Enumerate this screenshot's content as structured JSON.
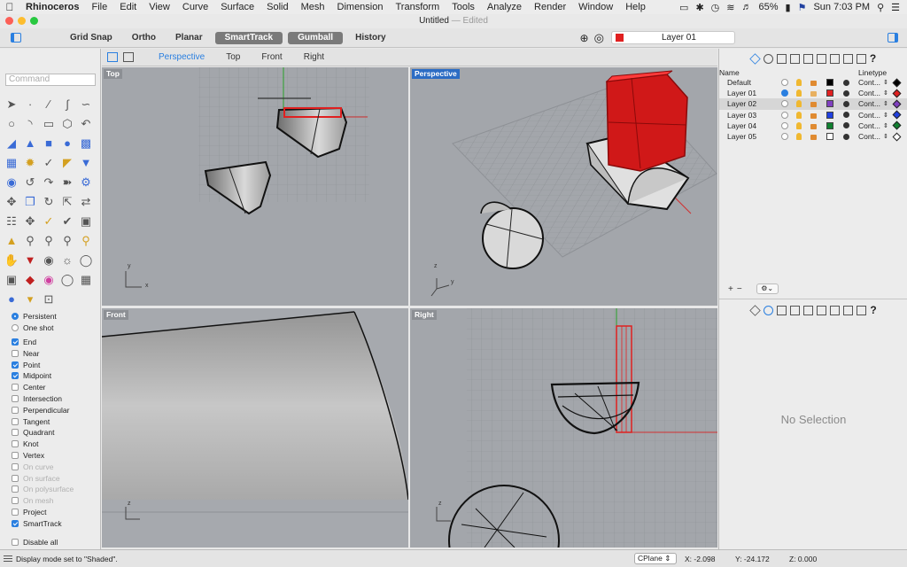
{
  "menubar": {
    "app_name": "Rhinoceros",
    "items": [
      "File",
      "Edit",
      "View",
      "Curve",
      "Surface",
      "Solid",
      "Mesh",
      "Dimension",
      "Transform",
      "Tools",
      "Analyze",
      "Render",
      "Window",
      "Help"
    ],
    "battery": "65%",
    "clock": "Sun 7:03 PM"
  },
  "window": {
    "title": "Untitled",
    "status": "Edited"
  },
  "toolbar": {
    "buttons": [
      {
        "label": "Grid Snap",
        "on": false
      },
      {
        "label": "Ortho",
        "on": false
      },
      {
        "label": "Planar",
        "on": false
      },
      {
        "label": "SmartTrack",
        "on": true
      },
      {
        "label": "Gumball",
        "on": true
      },
      {
        "label": "History",
        "on": false
      }
    ],
    "current_layer": "Layer 01",
    "current_layer_color": "#e02020"
  },
  "command": {
    "placeholder": "Command"
  },
  "viewport_tabs": [
    "Perspective",
    "Top",
    "Front",
    "Right"
  ],
  "active_tab": "Perspective",
  "viewports": {
    "top": "Top",
    "perspective": "Perspective",
    "front": "Front",
    "right": "Right"
  },
  "osnap": {
    "mode": [
      {
        "label": "Persistent",
        "selected": true
      },
      {
        "label": "One shot",
        "selected": false
      }
    ],
    "items": [
      {
        "label": "End",
        "checked": true,
        "enabled": true
      },
      {
        "label": "Near",
        "checked": false,
        "enabled": true
      },
      {
        "label": "Point",
        "checked": true,
        "enabled": true
      },
      {
        "label": "Midpoint",
        "checked": true,
        "enabled": true
      },
      {
        "label": "Center",
        "checked": false,
        "enabled": true
      },
      {
        "label": "Intersection",
        "checked": false,
        "enabled": true
      },
      {
        "label": "Perpendicular",
        "checked": false,
        "enabled": true
      },
      {
        "label": "Tangent",
        "checked": false,
        "enabled": true
      },
      {
        "label": "Quadrant",
        "checked": false,
        "enabled": true
      },
      {
        "label": "Knot",
        "checked": false,
        "enabled": true
      },
      {
        "label": "Vertex",
        "checked": false,
        "enabled": true
      },
      {
        "label": "On curve",
        "checked": false,
        "enabled": false
      },
      {
        "label": "On surface",
        "checked": false,
        "enabled": false
      },
      {
        "label": "On polysurface",
        "checked": false,
        "enabled": false
      },
      {
        "label": "On mesh",
        "checked": false,
        "enabled": false
      },
      {
        "label": "Project",
        "checked": false,
        "enabled": true
      },
      {
        "label": "SmartTrack",
        "checked": true,
        "enabled": true
      },
      {
        "label": "Disable all",
        "checked": false,
        "enabled": true
      }
    ]
  },
  "layers_panel": {
    "header_name": "Name",
    "header_linetype": "Linetype",
    "layers": [
      {
        "name": "Default",
        "current": false,
        "color": "#000000",
        "linetype": "Cont...",
        "selected": false
      },
      {
        "name": "Layer 01",
        "current": true,
        "color": "#e02020",
        "linetype": "Cont...",
        "selected": false
      },
      {
        "name": "Layer 02",
        "current": false,
        "color": "#8040c0",
        "linetype": "Cont...",
        "selected": true
      },
      {
        "name": "Layer 03",
        "current": false,
        "color": "#2040e0",
        "linetype": "Cont...",
        "selected": false
      },
      {
        "name": "Layer 04",
        "current": false,
        "color": "#108030",
        "linetype": "Cont...",
        "selected": false
      },
      {
        "name": "Layer 05",
        "current": false,
        "color": "#ffffff",
        "linetype": "Cont...",
        "selected": false
      }
    ],
    "add_label": "+",
    "remove_label": "−"
  },
  "properties": {
    "empty_message": "No Selection"
  },
  "statusbar": {
    "message": "Display mode set to \"Shaded\".",
    "cplane": "CPlane",
    "x": "X: -2.098",
    "y": "Y: -24.172",
    "z": "Z: 0.000"
  }
}
